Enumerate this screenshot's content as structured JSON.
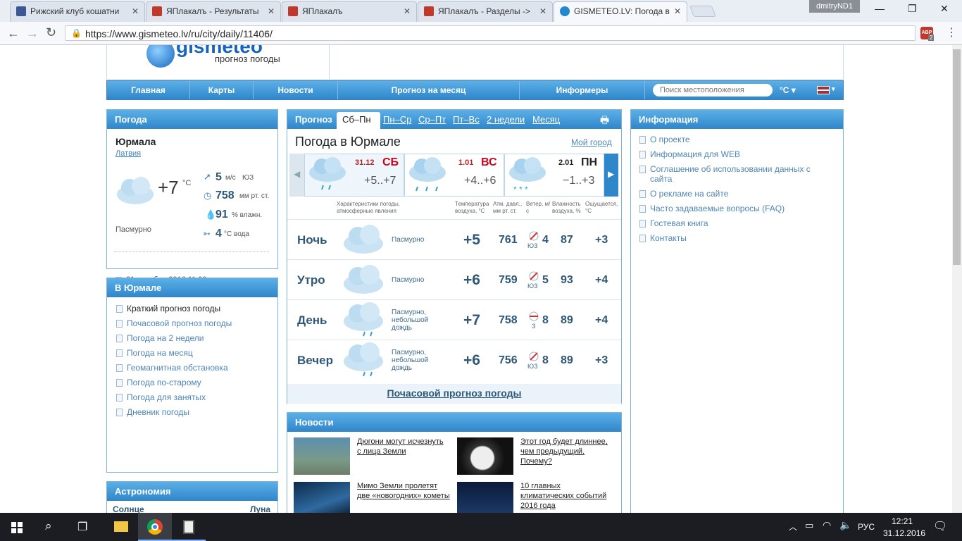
{
  "browser": {
    "tabs": [
      {
        "title": "Рижский клуб кошатни",
        "icon_color": "#3b5998"
      },
      {
        "title": "ЯПлакалъ - Результаты",
        "icon_color": "#c0392b"
      },
      {
        "title": "ЯПлакалъ",
        "icon_color": "#c0392b"
      },
      {
        "title": "ЯПлакалъ - Разделы ->",
        "icon_color": "#c0392b"
      },
      {
        "title": "GISMETEO.LV: Погода в",
        "icon_color": "#1e88d0"
      }
    ],
    "user": "dmitryND1",
    "url": "https://www.gismeteo.lv/ru/city/daily/11406/",
    "abp_badge": "2"
  },
  "site": {
    "logo_text": "gismeteo",
    "logo_sub": "прогноз погоды",
    "nav": [
      "Главная",
      "Карты",
      "Новости",
      "Прогноз на месяц",
      "Информеры"
    ],
    "search_placeholder": "Поиск местоположения",
    "unit": "°C"
  },
  "weather_panel": {
    "title": "Погода",
    "city": "Юрмала",
    "country": "Латвия",
    "temp": "+7",
    "temp_unit": "°C",
    "wind_speed": "5",
    "wind_unit": "м/с",
    "wind_dir": "ЮЗ",
    "pressure": "758",
    "pressure_unit": "мм рт. ст.",
    "humidity": "91",
    "humidity_unit": "% влажн.",
    "water": "4",
    "water_unit": "°C вода",
    "desc": "Пасмурно",
    "date": "31 декабря 2016 11:00"
  },
  "city_panel": {
    "title": "В Юрмале",
    "items": [
      "Краткий прогноз погоды",
      "Почасовой прогноз погоды",
      "Погода на 2 недели",
      "Погода на месяц",
      "Геомагнитная обстановка",
      "Погода по-старому",
      "Погода для занятых",
      "Дневник погоды"
    ]
  },
  "astro_panel": {
    "title": "Астрономия",
    "sun": "Солнце",
    "moon": "Луна"
  },
  "forecast": {
    "tabs": [
      "Прогноз",
      "Сб–Пн",
      "Пн–Ср",
      "Ср–Пт",
      "Пт–Вс",
      "2 недели",
      "Месяц"
    ],
    "heading": "Погода в Юрмале",
    "my_city": "Мой город",
    "days": [
      {
        "date": "31.12",
        "dow": "СБ",
        "temps": "+5..+7"
      },
      {
        "date": "1.01",
        "dow": "ВС",
        "temps": "+4..+6"
      },
      {
        "date": "2.01",
        "dow": "ПН",
        "temps": "−1..+3"
      }
    ],
    "col_headers": {
      "desc": "Характеристики погоды, атмосферные явления",
      "temp": "Температура воздуха, °C",
      "pressure": "Атм. давл., мм рт. ст.",
      "wind": "Ветер, м/с",
      "humidity": "Влажность воздуха, %",
      "feels": "Ощущается, °C"
    },
    "rows": [
      {
        "name": "Ночь",
        "desc": "Пасмурно",
        "temp": "+5",
        "pressure": "761",
        "wind": "4",
        "dir": "ЮЗ",
        "humidity": "87",
        "feels": "+3"
      },
      {
        "name": "Утро",
        "desc": "Пасмурно",
        "temp": "+6",
        "pressure": "759",
        "wind": "5",
        "dir": "ЮЗ",
        "humidity": "93",
        "feels": "+4"
      },
      {
        "name": "День",
        "desc": "Пасмурно, небольшой дождь",
        "temp": "+7",
        "pressure": "758",
        "wind": "8",
        "dir": "З",
        "humidity": "89",
        "feels": "+4"
      },
      {
        "name": "Вечер",
        "desc": "Пасмурно, небольшой дождь",
        "temp": "+6",
        "pressure": "756",
        "wind": "8",
        "dir": "ЮЗ",
        "humidity": "89",
        "feels": "+3"
      }
    ],
    "hourly_link": "Почасовой прогноз погоды"
  },
  "news": {
    "title": "Новости",
    "items": [
      "Дюгони могут исчезнуть с лица Земли",
      "Этот год будет длиннее, чем предыдущий. Почему?",
      "Мимо Земли пролетят две «новогодних» кометы",
      "10 главных климатических событий 2016 года"
    ]
  },
  "info_panel": {
    "title": "Информация",
    "items": [
      "О проекте",
      "Информация для WEB",
      "Соглашение об использовании данных с сайта",
      "О рекламе на сайте",
      "Часто задаваемые вопросы (FAQ)",
      "Гостевая книга",
      "Контакты"
    ]
  },
  "taskbar": {
    "lang": "РУС",
    "time": "12:21",
    "date": "31.12.2016"
  }
}
